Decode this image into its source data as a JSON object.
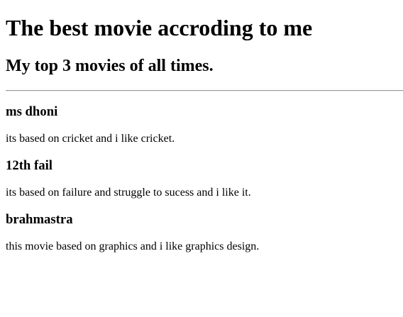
{
  "title": "The best movie accroding to me",
  "subtitle": "My top 3 movies of all times.",
  "movies": [
    {
      "name": "ms dhoni",
      "description": "its based on cricket and i like cricket."
    },
    {
      "name": "12th fail",
      "description": "its based on failure and struggle to sucess and i like it."
    },
    {
      "name": "brahmastra",
      "description": "this movie based on graphics and i like graphics design."
    }
  ]
}
